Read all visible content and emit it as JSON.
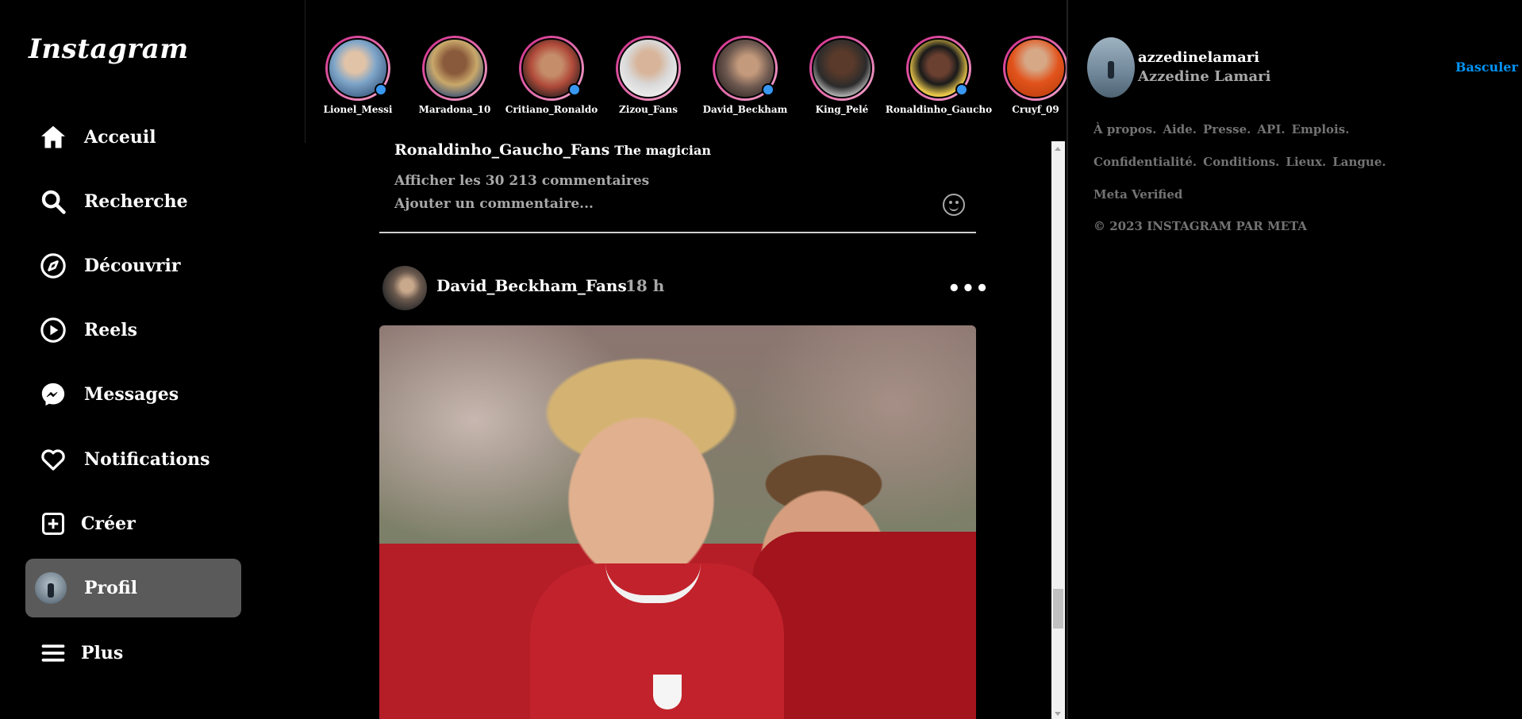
{
  "app": {
    "logo": "Instagram"
  },
  "sidebar": {
    "items": [
      {
        "label": "Acceuil",
        "icon": "home-icon"
      },
      {
        "label": "Recherche",
        "icon": "search-icon"
      },
      {
        "label": "Découvrir",
        "icon": "compass-icon"
      },
      {
        "label": "Reels",
        "icon": "reels-icon"
      },
      {
        "label": "Messages",
        "icon": "messenger-icon"
      },
      {
        "label": "Notifications",
        "icon": "heart-icon"
      },
      {
        "label": "Créer",
        "icon": "plus-square-icon"
      },
      {
        "label": "Profil",
        "icon": "avatar",
        "active": true
      },
      {
        "label": "Plus",
        "icon": "menu-icon"
      }
    ]
  },
  "stories": [
    {
      "name": "Lionel_Messi",
      "color": "#7fa6c9",
      "verified": true
    },
    {
      "name": "Maradona_10",
      "color": "#c9a86a",
      "verified": false
    },
    {
      "name": "Critiano_Ronaldo",
      "color": "#b04a3a",
      "verified": true
    },
    {
      "name": "Zizou_Fans",
      "color": "#d9d9d9",
      "verified": false
    },
    {
      "name": "David_Beckham",
      "color": "#6e5950",
      "verified": true
    },
    {
      "name": "King_Pelé",
      "color": "#ececec",
      "verified": false
    },
    {
      "name": "Ronaldinho_Gaucho",
      "color": "#e8c64a",
      "verified": true
    },
    {
      "name": "Cruyf_09",
      "color": "#e2531c",
      "verified": false
    }
  ],
  "prev_post": {
    "username": "Ronaldinho_Gaucho_Fans",
    "caption": "The magician",
    "view_comments": "Afficher les 30 213 commentaires",
    "add_comment_placeholder": "Ajouter un commentaire..."
  },
  "post": {
    "username": "David_Beckham_Fans",
    "time": "18 h",
    "more": "•••"
  },
  "profile": {
    "username": "azzedinelamari",
    "fullname": "Azzedine Lamari",
    "switch_label": "Basculer"
  },
  "footer": {
    "row1": [
      "À propos.",
      "Aide.",
      "Presse.",
      "API.",
      "Emplois."
    ],
    "row2": [
      "Confidentialité.",
      "Conditions.",
      "Lieux.",
      "Langue."
    ],
    "row3": [
      "Meta Verified"
    ],
    "copyright": "© 2023 INSTAGRAM PAR META"
  },
  "colors": {
    "accent": "#0095f6",
    "story_ring": "#d12a8a",
    "muted": "#a8a8a8"
  }
}
